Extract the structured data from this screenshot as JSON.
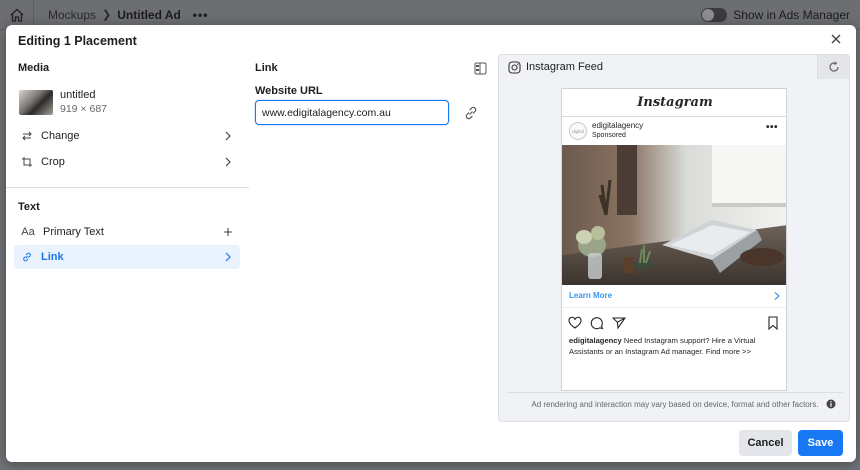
{
  "topbar": {
    "crumb1": "Mockups",
    "crumb2": "Untitled Ad",
    "more": "•••",
    "toggle_label": "Show in Ads Manager"
  },
  "modal": {
    "title": "Editing 1 Placement"
  },
  "media": {
    "section_title": "Media",
    "file_name": "untitled",
    "file_size": "919 × 687",
    "change_label": "Change",
    "crop_label": "Crop"
  },
  "text": {
    "section_title": "Text",
    "primary_text_label": "Primary Text",
    "link_label": "Link"
  },
  "link": {
    "section_title": "Link",
    "url_label": "Website URL",
    "url_value": "www.edigitalagency.com.au"
  },
  "preview": {
    "placement": "Instagram Feed",
    "ig_logo": "Instagram",
    "account": "edigitalagency",
    "avatar_text": "digital",
    "sponsored": "Sponsored",
    "more": "•••",
    "cta": "Learn More",
    "caption_account": "edigitalagency",
    "caption_text": "Need Instagram support? Hire a Virtual Assistants or an Instagram Ad manager. Find more >>",
    "disclaimer": "Ad rendering and interaction may vary based on device, format and other factors."
  },
  "footer": {
    "cancel": "Cancel",
    "save": "Save"
  },
  "colors": {
    "accent": "#1877f2",
    "active_row_bg": "#eaf2fd",
    "ig_link": "#3897f0"
  }
}
